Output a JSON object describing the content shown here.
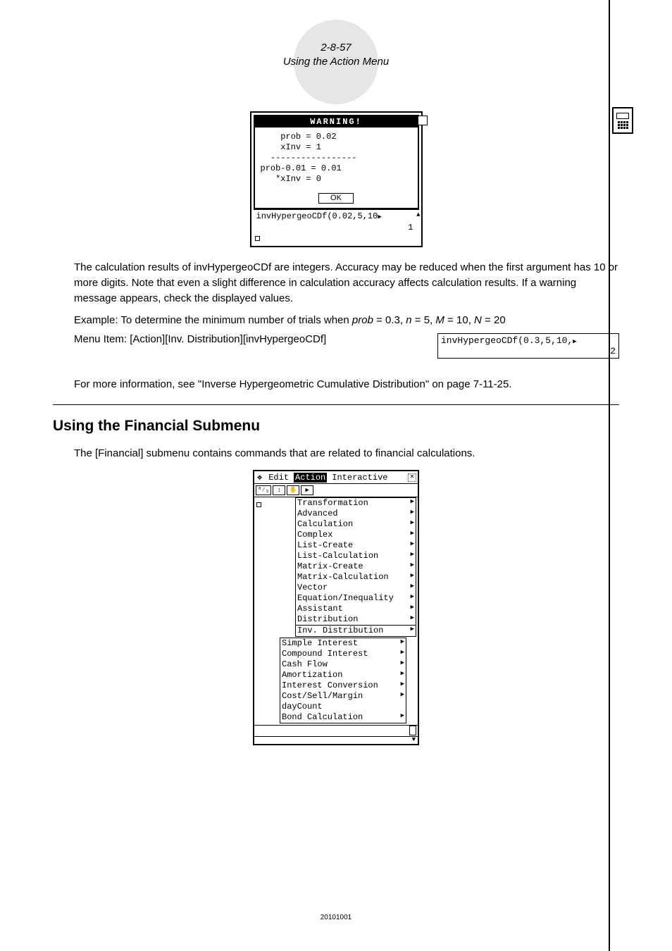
{
  "header": {
    "page_num": "2-8-57",
    "section": "Using the Action Menu"
  },
  "warning": {
    "title": "WARNING!",
    "body": "    prob = 0.02\n    xInv = 1\n  -----------------\nprob-0.01 = 0.01\n   *xInv = 0",
    "ok": "OK"
  },
  "calc1": {
    "expr": "invHypergeoCDf(0.02,5,10",
    "result": "1"
  },
  "body": {
    "p1": "The calculation results of invHypergeoCDf are integers. Accuracy may be reduced when the first argument has 10 or more digits. Note that even a slight difference in calculation accuracy affects calculation results. If a warning message appears, check the displayed values.",
    "example_prefix": "Example: To determine the minimum number of trials when ",
    "menu_item": "Menu Item: [Action][Inv. Distribution][invHypergeoCDf]",
    "inline_expr": "invHypergeoCDf(0.3,5,10,",
    "inline_result": "2",
    "info": "For more information, see \"Inverse Hypergeometric Cumulative Distribution\" on page 7-11-25."
  },
  "example_vars": {
    "prob": "0.3",
    "n": "5",
    "M": "10",
    "N": "20"
  },
  "h2": "Using the Financial Submenu",
  "p2": "The [Financial] submenu contains commands that are related to financial calculations.",
  "menubar": {
    "hat": "❖",
    "edit": "Edit",
    "action": "Action",
    "interactive": "Interactive"
  },
  "menu1": [
    "Transformation",
    "Advanced",
    "Calculation",
    "Complex",
    "List-Create",
    "List-Calculation",
    "Matrix-Create",
    "Matrix-Calculation",
    "Vector",
    "Equation/Inequality",
    "Assistant",
    "Distribution",
    "Inv. Distribution"
  ],
  "menu2": [
    {
      "label": "Simple Interest",
      "arrow": true
    },
    {
      "label": "Compound Interest",
      "arrow": true
    },
    {
      "label": "Cash Flow",
      "arrow": true
    },
    {
      "label": "Amortization",
      "arrow": true
    },
    {
      "label": "Interest Conversion",
      "arrow": true
    },
    {
      "label": "Cost/Sell/Margin",
      "arrow": true
    },
    {
      "label": "dayCount",
      "arrow": false
    },
    {
      "label": "Bond Calculation",
      "arrow": true
    }
  ],
  "footer": "20101001"
}
